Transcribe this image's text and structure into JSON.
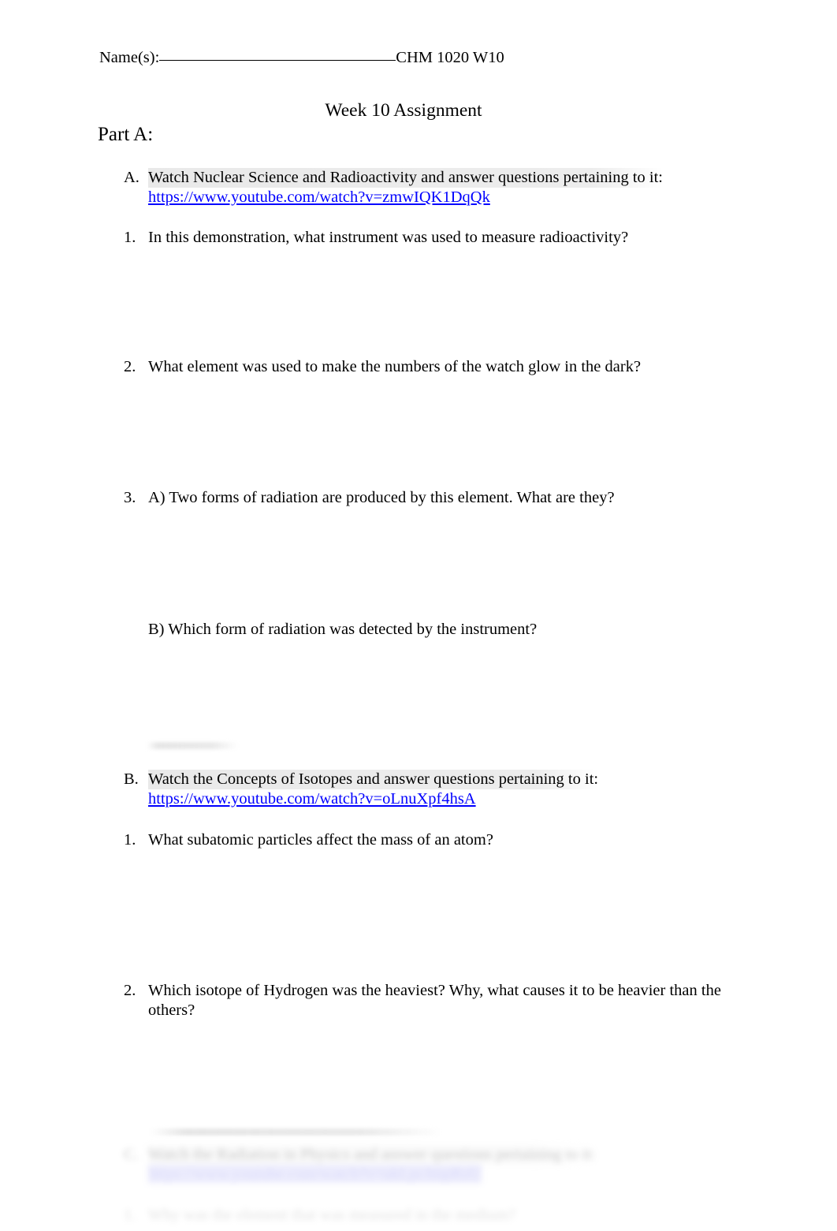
{
  "document": {
    "header": {
      "name_label": "Name(s):",
      "course_code": "CHM 1020 W10"
    },
    "title": "Week 10 Assignment",
    "part_heading": "Part A:"
  },
  "section_a": {
    "marker": "A.",
    "instruction": "Watch Nuclear Science and Radioactivity and answer questions pertaining to it:",
    "url": "https://www.youtube.com/watch?v=zmwIQK1DqQk",
    "questions": [
      {
        "marker": "1.",
        "text": "In this demonstration, what instrument was used to measure radioactivity?"
      },
      {
        "marker": "2.",
        "text": "What element was used to make the numbers of the watch glow in the dark?"
      },
      {
        "marker": "3.",
        "text": "A) Two forms of radiation are produced by this element. What are they?",
        "part_b": "B) Which form of radiation was detected by the instrument?"
      }
    ]
  },
  "section_b": {
    "marker": "B.",
    "instruction": "Watch the Concepts of Isotopes and answer questions pertaining to it:",
    "url": "https://www.youtube.com/watch?v=oLnuXpf4hsA",
    "questions": [
      {
        "marker": "1.",
        "text": "What subatomic particles affect the mass of an atom?"
      },
      {
        "marker": "2.",
        "text": "Which isotope of Hydrogen was the heaviest? Why, what causes it to be heavier than the others?"
      }
    ]
  },
  "section_c": {
    "marker": "C.",
    "instruction": "Watch the Radiation in Physics and answer questions pertaining to it:",
    "url": "https://www.youtube.com/watch?v=ukLpcJmpRzU",
    "questions": [
      {
        "marker": "1.",
        "text": "Why was the element that was measured in the medium?"
      }
    ]
  },
  "colors": {
    "link": "#0000FF",
    "text": "#000000",
    "highlight": "#E8E8E8",
    "page_background": "#FFFFFF"
  }
}
